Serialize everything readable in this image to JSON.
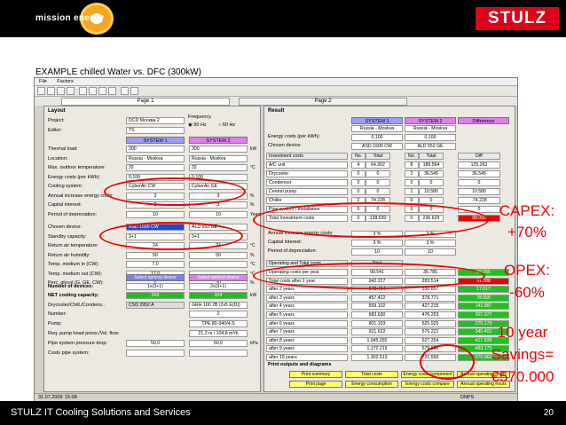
{
  "header": {
    "brand_left": "mission energy",
    "brand_right": "STULZ"
  },
  "subtitle": "EXAMPLE chilled Water vs. DFC (300kW)",
  "menu": {
    "file": "File",
    "factors": "Factors"
  },
  "tabs": {
    "page1": "Page 1",
    "page2": "Page 2"
  },
  "layout": {
    "title": "Layout",
    "project_label": "Project:",
    "project_value": "DCD Москва 2",
    "editor_label": "Editor:",
    "editor_value": "TS",
    "frequency_label": "Frequency",
    "freq50": "50 Hz",
    "freq60": "60 Hz",
    "system1": "SYSTEM 1",
    "system2": "SYSTEM 2",
    "rows": [
      {
        "label": "Thermal load:",
        "v1": "300",
        "v2": "300",
        "unit": "kW"
      },
      {
        "label": "Location:",
        "v1": "Russia - Moskva",
        "v2": "Russia - Moskva",
        "unit": ""
      },
      {
        "label": "Max. outdoor temperature:",
        "v1": "32",
        "v2": "32",
        "unit": "°C"
      },
      {
        "label": "Energy costs (per kWh):",
        "v1": "0,100",
        "v2": "0,100",
        "unit": ""
      },
      {
        "label": "Cooling system:",
        "v1": "CyberAir CW",
        "v2": "CyberAir GE",
        "unit": ""
      },
      {
        "label": "Annual increase energy costs:",
        "v1": "3",
        "v2": "3",
        "unit": "%"
      },
      {
        "label": "Capital interest:",
        "v1": "3",
        "v2": "3",
        "unit": "%"
      },
      {
        "label": "Period of depreciation:",
        "v1": "10",
        "v2": "10",
        "unit": "Years"
      },
      {
        "label": "Chosen device:",
        "v1": "ASD 1500 CW",
        "v2": "ALD 552 GE",
        "unit": ""
      },
      {
        "label": "Standby capacity:",
        "v1": "3+1",
        "v2": "3+1",
        "unit": ""
      },
      {
        "label": "Return air temperature:",
        "v1": "24",
        "v2": "24",
        "unit": "°C"
      },
      {
        "label": "Return air humidity:",
        "v1": "50",
        "v2": "50",
        "unit": "%"
      },
      {
        "label": "Temp. medium in (CW):",
        "v1": "7,0",
        "v2": "",
        "unit": "°C"
      },
      {
        "label": "Temp. medium out (CW):",
        "v1": "12,0",
        "v2": "",
        "unit": "°C"
      },
      {
        "label": "Perc. glycol (G, GE, CW):",
        "v1": "0",
        "v2": "30",
        "unit": "%"
      }
    ],
    "select_optimal": "Select optimal device",
    "devices_label": "Number of devices:",
    "devices_v1": "1x(3+1)",
    "devices_v2": "2x(3+1)",
    "netcap_label": "NET cooling capacity:",
    "netcap_v1": "343",
    "netcap_v2": "324",
    "netcap_unit": "kW",
    "drycooler_label": "Drycooler/Chill./Condens.:",
    "drycooler_v1": "CSD 2952 A",
    "drycooler_v2": "GRH 100 2B (2x5 E(D))",
    "number_label": "Number:",
    "number_v2": "2",
    "pump_label": "Pump:",
    "pump_v2": "TPE 80-340/4-S",
    "headpress_label": "Req. pump head press./Vol. flow:",
    "headpress_v2": "21,3 m / 104,8 m³/h",
    "pipepress_label": "Pipe system pressure drop:",
    "pipepress_v1": "50,0",
    "pipepress_v2": "50,0",
    "pipepress_unit": "kPa",
    "costs_label": "Costs pipe system:"
  },
  "result": {
    "title": "Result",
    "sys1": "SYSTEM 1",
    "sys2": "SYSTEM 2",
    "diff": "Difference",
    "loc_v1": "Russia - Moskva",
    "loc_v2": "Russia - Moskva",
    "energy_label": "Energy costs (per kWh):",
    "energy_v1": "0,100",
    "energy_v2": "0,100",
    "chosen_label": "Chosen device:",
    "chosen_v1": "ASD 1500 CW",
    "chosen_v2": "ALD 552 GE",
    "inv_headers": [
      "Investment costs",
      "No.",
      "Total",
      "No.",
      "Total",
      "Diff"
    ],
    "inv_rows": [
      [
        "A/C unit",
        "4",
        "64.302",
        "8",
        "189.564",
        "125.262"
      ],
      [
        "Drycooler",
        "0",
        "0",
        "2",
        "36.545",
        "36.545"
      ],
      [
        "Condensor",
        "0",
        "0",
        "0",
        "0",
        "0"
      ],
      [
        "Central pump",
        "0",
        "0",
        "1",
        "10.580",
        "10.580"
      ],
      [
        "Chiller",
        "2",
        "74.228",
        "0",
        "0",
        "-74.228"
      ],
      [
        "Pipe system / Installation",
        "0",
        "0",
        "0",
        "0",
        "0"
      ],
      [
        "Total Investment costs",
        "0",
        "138.530",
        "0",
        "236.629",
        "98.099"
      ]
    ],
    "annual_label": "Annual increase energy costs:",
    "annual_v1": "3 %",
    "annual_v2": "3 %",
    "capital_label": "Capital interest:",
    "capital_v1": "3 %",
    "capital_v2": "3 %",
    "period_label": "Period of depreciation:",
    "period_v1": "10",
    "period_v2": "10",
    "op_header": "Operating and Total costs",
    "op_total": "Total",
    "op_rows": [
      [
        "Operating costs per year",
        "99.541",
        "35.786",
        "59.755"
      ],
      [
        "Total costs after 1 year",
        "242.227",
        "283.514",
        "41.288"
      ],
      [
        "after 2 years",
        "348.494",
        "330.857",
        "17.617"
      ],
      [
        "after 3 years",
        "457.422",
        "378.771",
        "78.650"
      ],
      [
        "after 4 years",
        "569.102",
        "427.215",
        "141.887"
      ],
      [
        "after 5 years",
        "683.630",
        "476.253",
        "207.377"
      ],
      [
        "after 6 years",
        "801.103",
        "525.925",
        "275.179"
      ],
      [
        "after 7 years",
        "921.622",
        "576.221",
        "345.401"
      ],
      [
        "after 8 years",
        "1.045.292",
        "627.354",
        "417.938"
      ],
      [
        "after 9 years",
        "1.172.219",
        "679.045",
        "493.173"
      ],
      [
        "after 10 years",
        "1.302.513",
        "731.550",
        "570.963"
      ]
    ],
    "print_label": "Print outputs and diagrams",
    "buttons": [
      "Print summary",
      "Total costs",
      "Energy costs component",
      "Annual operating hours",
      "Print page",
      "Energy consumption",
      "Energy costs compare",
      "Annual operating hours"
    ]
  },
  "status": {
    "date": "31.07.2009",
    "time": "15:08",
    "mode": "DNPS"
  },
  "callouts": {
    "capex_label": "CAPEX:",
    "capex_value": "+70%",
    "opex_label": "OPEX:",
    "opex_value": "-60%",
    "savings_line1": "10 year",
    "savings_line2": "Savings=",
    "savings_line3": "€570.000"
  },
  "footer": {
    "text": "STULZ  IT Cooling Solutions and Services",
    "page": "20"
  }
}
